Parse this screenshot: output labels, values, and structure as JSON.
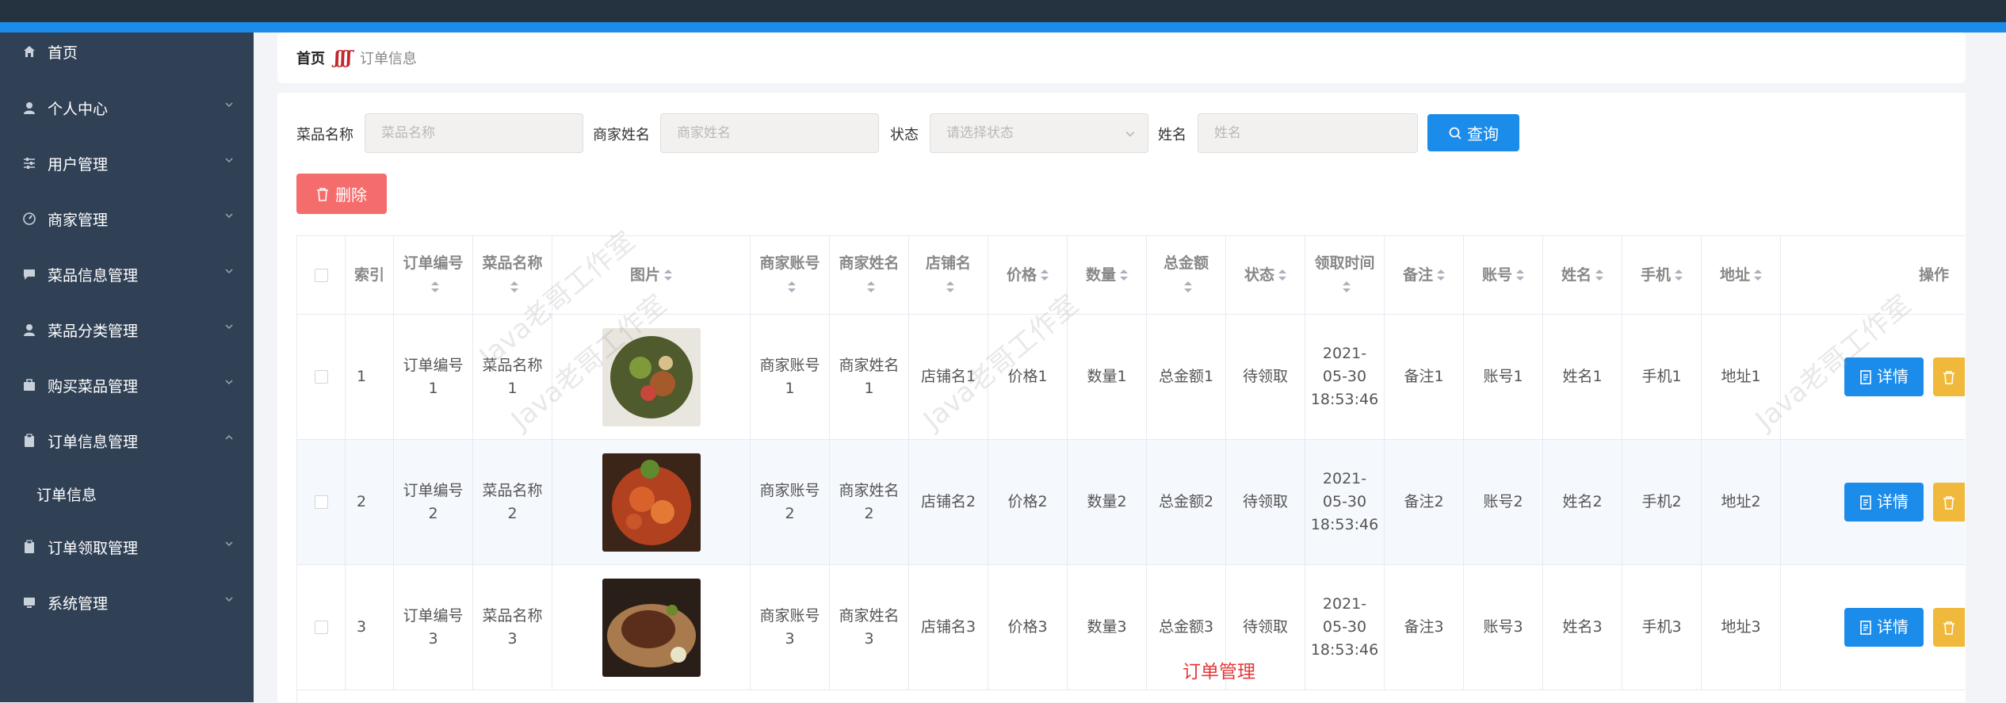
{
  "sidebar": {
    "items": [
      {
        "label": "首页",
        "icon": "home-icon"
      },
      {
        "label": "个人中心",
        "icon": "user-icon"
      },
      {
        "label": "用户管理",
        "icon": "sliders-icon"
      },
      {
        "label": "商家管理",
        "icon": "compass-icon"
      },
      {
        "label": "菜品信息管理",
        "icon": "chat-icon"
      },
      {
        "label": "菜品分类管理",
        "icon": "user-icon"
      },
      {
        "label": "购买菜品管理",
        "icon": "briefcase-icon"
      },
      {
        "label": "订单信息管理",
        "icon": "clipboard-icon"
      },
      {
        "label": "订单领取管理",
        "icon": "clipboard-icon"
      },
      {
        "label": "系统管理",
        "icon": "monitor-icon"
      }
    ],
    "sub_item": "订单信息"
  },
  "breadcrumb": {
    "home": "首页",
    "separator": "ʃʃʃ",
    "current": "订单信息"
  },
  "search": {
    "dish_label": "菜品名称",
    "dish_placeholder": "菜品名称",
    "merchant_label": "商家姓名",
    "merchant_placeholder": "商家姓名",
    "status_label": "状态",
    "status_placeholder": "请选择状态",
    "name_label": "姓名",
    "name_placeholder": "姓名",
    "query_button": "查询"
  },
  "toolbar": {
    "delete_button": "删除"
  },
  "table": {
    "headers": [
      "索引",
      "订单编号",
      "菜品名称",
      "图片",
      "商家账号",
      "商家姓名",
      "店铺名",
      "价格",
      "数量",
      "总金额",
      "状态",
      "领取时间",
      "备注",
      "账号",
      "姓名",
      "手机",
      "地址",
      "操作"
    ],
    "rows": [
      {
        "index": "1",
        "order_no": "订单编号1",
        "dish": "菜品名称1",
        "image": "dish-salad-image",
        "merchant_account": "商家账号1",
        "merchant_name": "商家姓名1",
        "shop": "店铺名1",
        "price": "价格1",
        "qty": "数量1",
        "total": "总金额1",
        "status": "待领取",
        "time": "2021-05-30 18:53:46",
        "note": "备注1",
        "account": "账号1",
        "name": "姓名1",
        "phone": "手机1",
        "address": "地址1"
      },
      {
        "index": "2",
        "order_no": "订单编号2",
        "dish": "菜品名称2",
        "image": "dish-crayfish-image",
        "merchant_account": "商家账号2",
        "merchant_name": "商家姓名2",
        "shop": "店铺名2",
        "price": "价格2",
        "qty": "数量2",
        "total": "总金额2",
        "status": "待领取",
        "time": "2021-05-30 18:53:46",
        "note": "备注2",
        "account": "账号2",
        "name": "姓名2",
        "phone": "手机2",
        "address": "地址2"
      },
      {
        "index": "3",
        "order_no": "订单编号3",
        "dish": "菜品名称3",
        "image": "dish-steak-image",
        "merchant_account": "商家账号3",
        "merchant_name": "商家姓名3",
        "shop": "店铺名3",
        "price": "价格3",
        "qty": "数量3",
        "total": "总金额3",
        "status": "待领取",
        "time": "2021-05-30 18:53:46",
        "note": "备注3",
        "account": "账号3",
        "name": "姓名3",
        "phone": "手机3",
        "address": "地址3"
      }
    ],
    "detail_button": "详情"
  },
  "watermark": "Java老哥工作室",
  "caption": "订单管理",
  "colors": {
    "primary": "#1c8ceb",
    "danger": "#f56c6c",
    "warning": "#f0b93b",
    "sidebar": "#304156",
    "topbar": "#253341"
  }
}
